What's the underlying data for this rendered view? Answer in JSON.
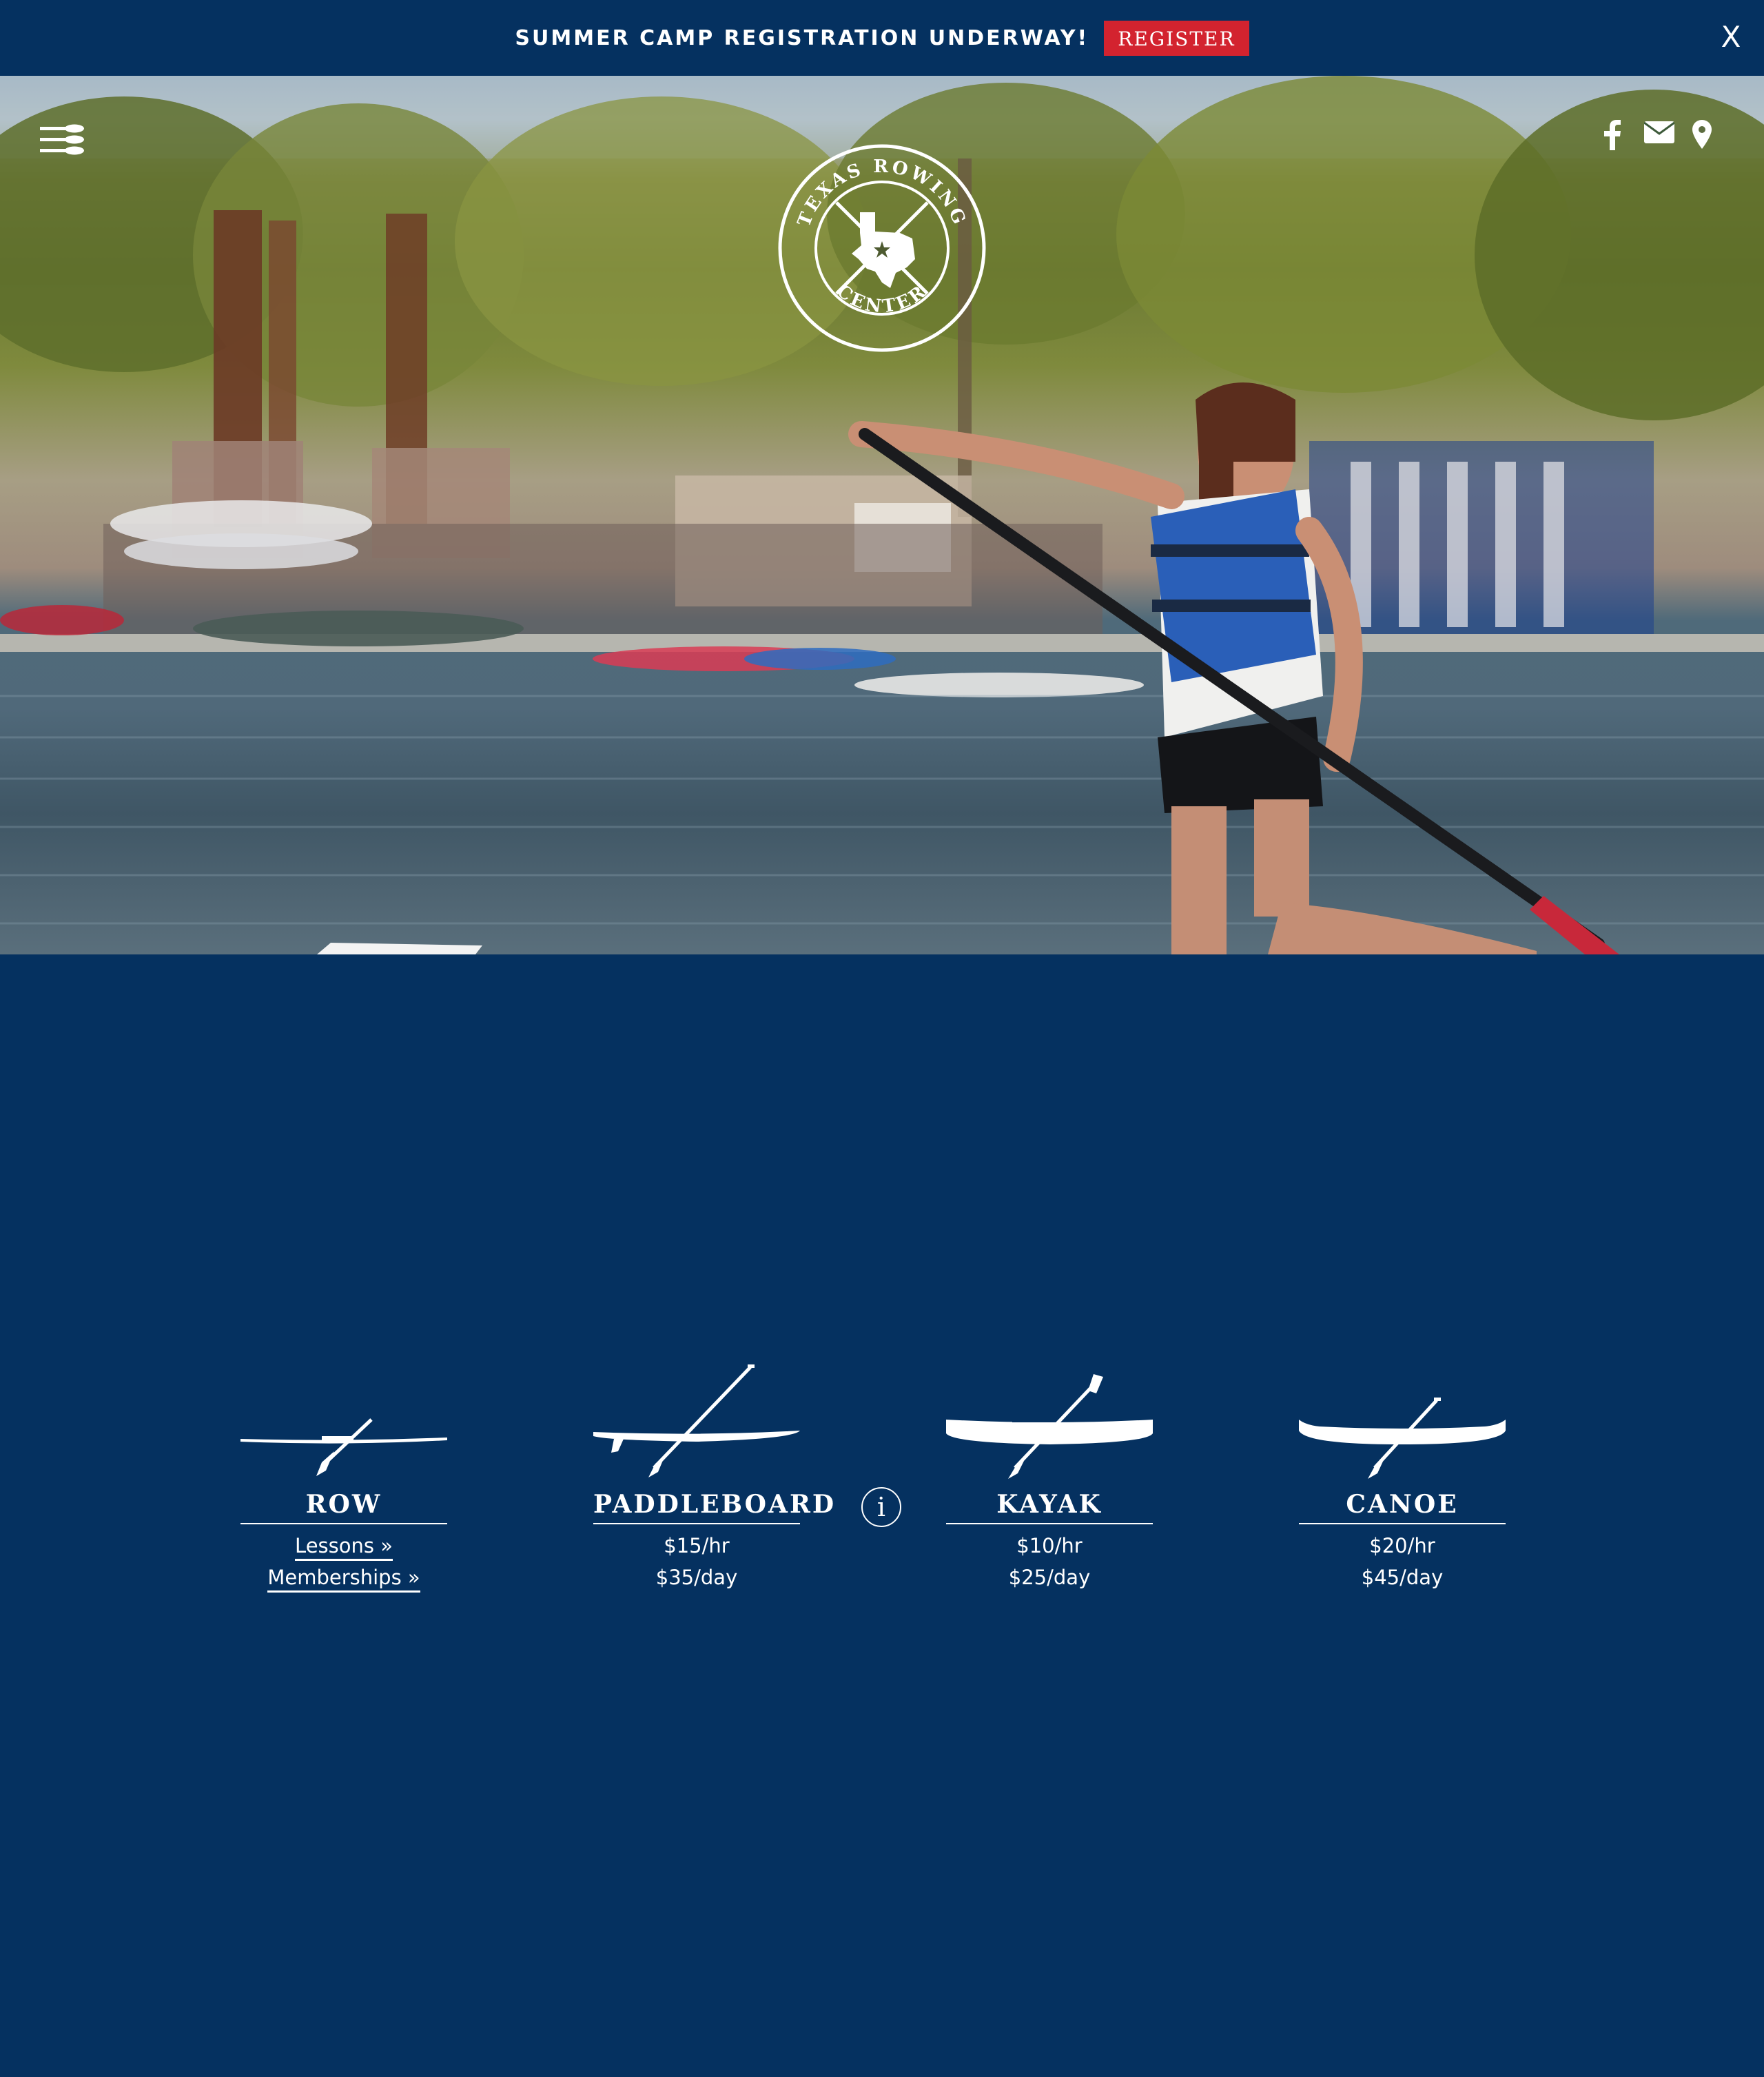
{
  "announcement": {
    "text": "SUMMER CAMP REGISTRATION UNDERWAY!",
    "register_label": "REGISTER",
    "close_label": "X",
    "register_color": "#d3232f"
  },
  "header": {
    "menu_icon": "oars-menu-icon",
    "social": [
      "facebook-icon",
      "envelope-icon",
      "map-pin-icon"
    ]
  },
  "logo": {
    "top_text": "TEXAS ROWING",
    "bottom_text": "CENTER",
    "icon": "texas-star-oars-icon"
  },
  "rentals": {
    "info_label": "i",
    "items": [
      {
        "title": "ROW",
        "icon": "rowing-shell-icon",
        "lines": [
          "Lessons »",
          "Memberships »"
        ]
      },
      {
        "title": "PADDLEBOARD",
        "icon": "paddleboard-icon",
        "lines": [
          "$15/hr",
          "$35/day"
        ]
      },
      {
        "title": "KAYAK",
        "icon": "kayak-icon",
        "lines": [
          "$10/hr",
          "$25/day"
        ]
      },
      {
        "title": "CANOE",
        "icon": "canoe-icon",
        "lines": [
          "$20/hr",
          "$45/day"
        ]
      }
    ]
  },
  "colors": {
    "navy": "#053160",
    "red": "#d3232f",
    "white": "#ffffff"
  }
}
